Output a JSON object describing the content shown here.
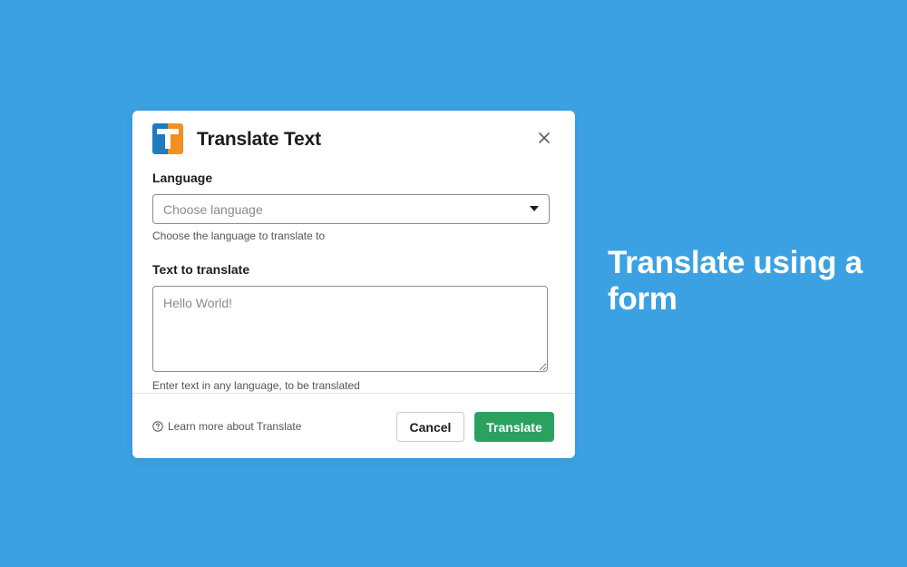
{
  "modal": {
    "title": "Translate Text",
    "icon": "translate-app-icon",
    "close_icon": "close-icon"
  },
  "form": {
    "language": {
      "label": "Language",
      "placeholder": "Choose language",
      "hint": "Choose the language to translate to"
    },
    "text": {
      "label": "Text to translate",
      "placeholder": "Hello World!",
      "hint": "Enter text in any language, to be translated"
    }
  },
  "footer": {
    "learn_more": "Learn more about Translate",
    "cancel_label": "Cancel",
    "submit_label": "Translate"
  },
  "promo": {
    "headline": "Translate using a form"
  },
  "colors": {
    "background": "#3ba1e3",
    "primary_button": "#2ba160",
    "icon_blue": "#1f7ac0",
    "icon_orange": "#f4901f"
  }
}
